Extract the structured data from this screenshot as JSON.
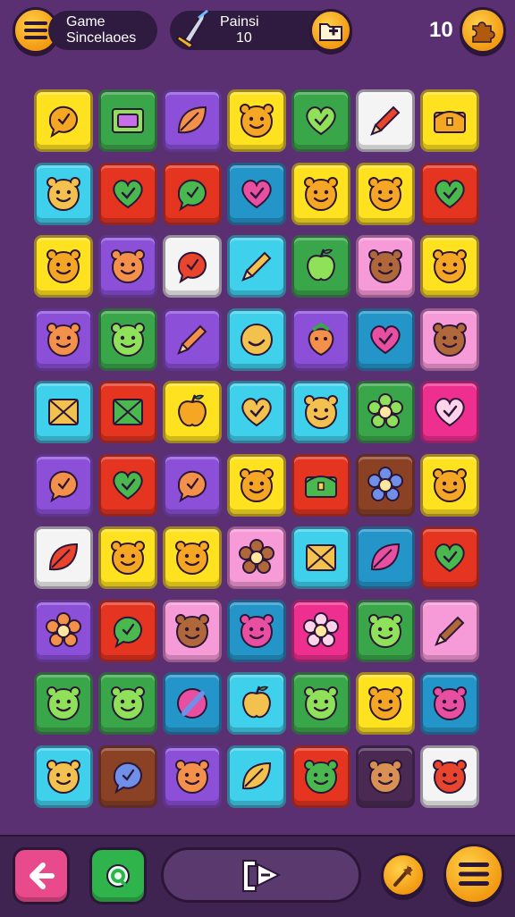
{
  "header": {
    "menu_icon": "hamburger-icon",
    "title_line1": "Game",
    "title_line2": "Sincelaoes",
    "points_line1": "Painsi",
    "points_line2": "10",
    "points_icon": "sword-icon",
    "plus_icon": "folder-plus-icon",
    "score_value": "10",
    "puzzle_icon": "puzzle-icon"
  },
  "board": {
    "columns": 7,
    "rows": 10,
    "tiles": [
      [
        "yellow:bubble",
        "green:folder",
        "purple:leaf",
        "yellow:face",
        "green:heart",
        "white:pencil",
        "yellow:chest"
      ],
      [
        "cyan:face",
        "red:heart",
        "red:bubble",
        "blue:heart",
        "yellow:face",
        "yellow:face",
        "red:heart"
      ],
      [
        "yellow:face",
        "purple:face",
        "white:bubble",
        "cyan:pencil",
        "green:apple",
        "pink:face",
        "yellow:face"
      ],
      [
        "purple:face",
        "green:face",
        "purple:pencil",
        "cyan:smile",
        "purple:berry",
        "blue:heart",
        "pink:face"
      ],
      [
        "cyan:box",
        "red:box",
        "yellow:apple",
        "cyan:heart",
        "cyan:face",
        "green:flower",
        "magenta:heart"
      ],
      [
        "purple:bubble",
        "red:heart",
        "purple:bubble",
        "yellow:face",
        "red:chest",
        "brown:flower",
        "yellow:face"
      ],
      [
        "white:leaf",
        "yellow:face",
        "yellow:face",
        "pink:flower",
        "cyan:box",
        "blue:leaf",
        "red:heart"
      ],
      [
        "purple:flower",
        "red:bubble",
        "pink:face",
        "blue:face",
        "magenta:flower",
        "green:face",
        "pink:pencil"
      ],
      [
        "green:face",
        "green:face",
        "blue:ball",
        "cyan:apple",
        "green:face",
        "yellow:face",
        "blue:face"
      ],
      [
        "cyan:face",
        "brown:bubble",
        "purple:face",
        "cyan:leaf",
        "red:face",
        "dark:face",
        "white:face"
      ]
    ]
  },
  "bottom": {
    "back_icon": "back-arrow-icon",
    "refresh_icon": "refresh-icon",
    "shuffle_icon": "shuffle-icon",
    "wand_icon": "magic-wand-icon",
    "menu_icon": "list-icon"
  },
  "colors": {
    "background": "#5a3073",
    "accent": "#f5a623",
    "yellow": "#ffe21f",
    "green": "#3aa64a",
    "purple": "#8b4fd8",
    "white": "#f4f4f4",
    "cyan": "#3fd0ec",
    "red": "#e5341f",
    "blue": "#2495c9",
    "pink": "#f79ad8",
    "magenta": "#ee2f8f",
    "brown": "#8a4124",
    "dark": "#4a2a52"
  }
}
